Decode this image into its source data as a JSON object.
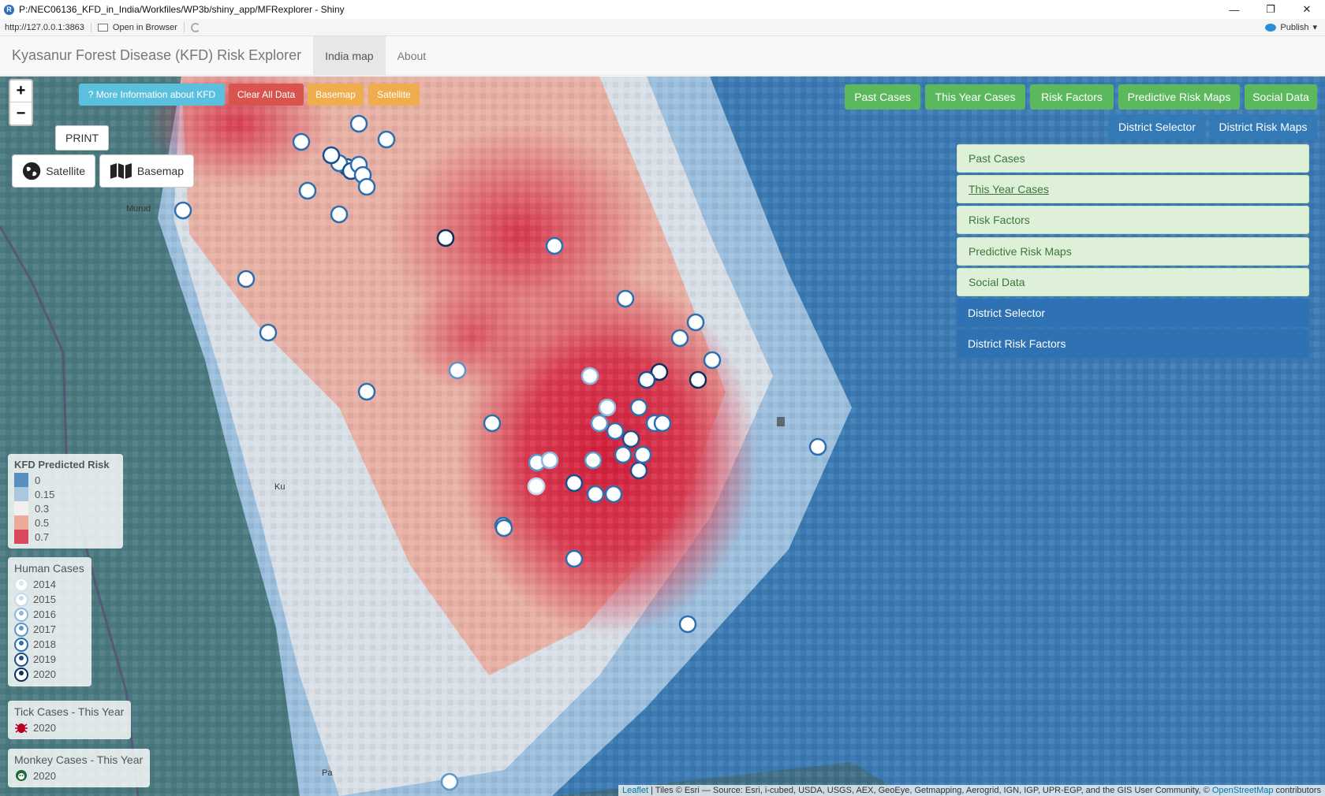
{
  "window": {
    "title": "P:/NEC06136_KFD_in_India/Workfiles/WP3b/shiny_app/MFRexplorer - Shiny",
    "controls": [
      "—",
      "❐",
      "✕"
    ]
  },
  "addressbar": {
    "url": "http://127.0.0.1:3863",
    "open_in_browser": "Open in Browser",
    "publish": "Publish"
  },
  "navbar": {
    "brand": "Kyasanur Forest Disease (KFD) Risk Explorer",
    "tabs": [
      "India map",
      "About"
    ],
    "active_tab": "India map"
  },
  "map": {
    "zoom_in": "+",
    "zoom_out": "−",
    "top_buttons": {
      "more_info": "? More Information about KFD",
      "clear": "Clear All Data",
      "basemap": "Basemap",
      "satellite": "Satellite"
    },
    "print": "PRINT",
    "layer_satellite": "Satellite",
    "layer_basemap": "Basemap",
    "right_buttons": [
      "Past Cases",
      "This Year Cases",
      "Risk Factors",
      "Predictive Risk Maps",
      "Social Data"
    ],
    "right_buttons_2": [
      "District Selector",
      "District Risk Maps"
    ],
    "panel": [
      "Past Cases",
      "This Year Cases",
      "Risk Factors",
      "Predictive Risk Maps",
      "Social Data",
      "District Selector",
      "District Risk Factors"
    ],
    "place_labels": [
      "Murud",
      "Ku",
      "Pa"
    ],
    "legend_risk": {
      "title": "KFD Predicted Risk",
      "items": [
        {
          "label": "0",
          "color": "#5b8ec0"
        },
        {
          "label": "0.15",
          "color": "#a9c8e0"
        },
        {
          "label": "0.3",
          "color": "#f2f0ef"
        },
        {
          "label": "0.5",
          "color": "#eeaa98"
        },
        {
          "label": "0.7",
          "color": "#d9495c"
        }
      ]
    },
    "legend_human": {
      "title": "Human Cases",
      "items": [
        {
          "label": "2014",
          "color": "#d7e6f2"
        },
        {
          "label": "2015",
          "color": "#c4daec"
        },
        {
          "label": "2016",
          "color": "#8cb8da"
        },
        {
          "label": "2017",
          "color": "#5b97c9"
        },
        {
          "label": "2018",
          "color": "#2d6fae"
        },
        {
          "label": "2019",
          "color": "#1a4f8c"
        },
        {
          "label": "2020",
          "color": "#0d2f5c"
        }
      ]
    },
    "legend_tick": {
      "title": "Tick Cases - This Year",
      "items": [
        {
          "label": "2020",
          "color": "#b8001f"
        }
      ]
    },
    "legend_monkey": {
      "title": "Monkey Cases - This Year",
      "items": [
        {
          "label": "2020",
          "color": "#1f6b3a"
        }
      ]
    },
    "attribution": {
      "leaflet": "Leaflet",
      "text": " | Tiles © Esri — Source: Esri, i-cubed, USDA, USGS, AEX, GeoEye, Getmapping, Aerogrid, IGN, IGP, UPR-EGP, and the GIS User Community, © ",
      "osm": "OpenStreetMap",
      "suffix": " contributors"
    }
  }
}
